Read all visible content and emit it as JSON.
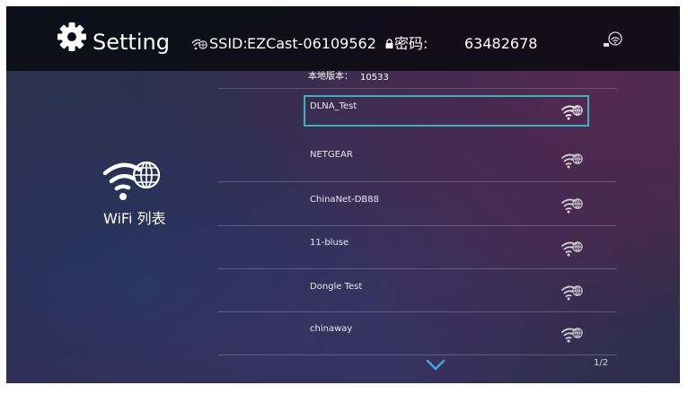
{
  "header": {
    "title": "Setting",
    "ssid_label": "SSID:",
    "ssid_value": "EZCast-06109562",
    "password_label": "密码:",
    "password_value": "63482678"
  },
  "version": {
    "label": "本地版本：",
    "value": "10533"
  },
  "side_panel": {
    "title": "WiFi 列表"
  },
  "wifi_list": {
    "selected_index": 0,
    "items": [
      {
        "name": "DLNA_Test"
      },
      {
        "name": "NETGEAR"
      },
      {
        "name": "ChinaNet-DB88"
      },
      {
        "name": "11-bluse"
      },
      {
        "name": "Dongle Test"
      },
      {
        "name": "chinaway"
      }
    ]
  },
  "pagination": {
    "page": "1/2"
  },
  "colors": {
    "selection_border": "#39b3bf",
    "header_bg": "#0a0a12",
    "text": "#ffffff"
  },
  "icons": {
    "gear": "gear-icon",
    "ssid": "wifi-globe-small-icon",
    "lock": "lock-icon",
    "status": "wifi-status-icon",
    "panel": "wifi-globe-icon",
    "signal": "wifi-globe-signal-icon",
    "scroll": "chevron-down-icon"
  }
}
